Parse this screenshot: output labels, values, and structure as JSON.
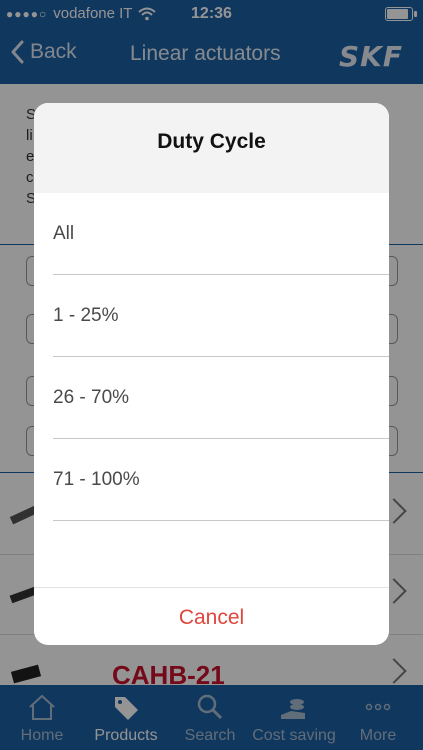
{
  "status_bar": {
    "carrier": "vodafone IT",
    "time": "12:36"
  },
  "nav": {
    "back_label": "Back",
    "title": "Linear actuators",
    "logo": "SKF"
  },
  "background": {
    "text_first_letters": [
      "S",
      "li",
      "e",
      "c",
      "S"
    ],
    "product_name": "CAHB-21"
  },
  "tabs": [
    {
      "label": "Home",
      "icon": "home-icon"
    },
    {
      "label": "Products",
      "icon": "tag-icon"
    },
    {
      "label": "Search",
      "icon": "search-icon"
    },
    {
      "label": "Cost saving",
      "icon": "cost-saving-icon"
    },
    {
      "label": "More",
      "icon": "more-icon"
    }
  ],
  "picker": {
    "title": "Duty Cycle",
    "options": [
      "All",
      "1 - 25%",
      "26 - 70%",
      "71 - 100%"
    ],
    "cancel_label": "Cancel"
  },
  "colors": {
    "brand_blue": "#1d5fa3",
    "cancel_red": "#e0463c",
    "product_red": "#c8102e"
  }
}
